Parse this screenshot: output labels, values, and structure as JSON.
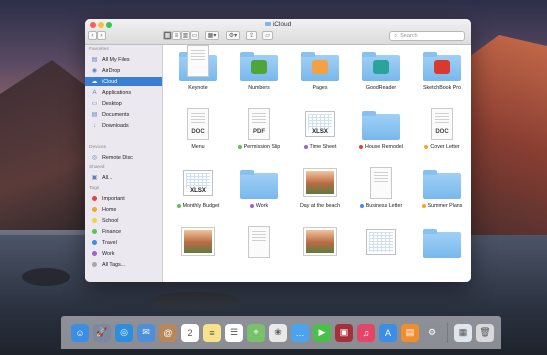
{
  "window": {
    "title": "iCloud"
  },
  "toolbar": {
    "search_placeholder": "Search"
  },
  "sidebar": {
    "favorites_label": "Favorites",
    "favorites": [
      {
        "label": "All My Files",
        "icon": "all-files-icon"
      },
      {
        "label": "AirDrop",
        "icon": "airdrop-icon"
      },
      {
        "label": "iCloud",
        "icon": "icloud-icon",
        "selected": true
      },
      {
        "label": "Applications",
        "icon": "applications-icon"
      },
      {
        "label": "Desktop",
        "icon": "desktop-icon"
      },
      {
        "label": "Documents",
        "icon": "documents-icon"
      },
      {
        "label": "Downloads",
        "icon": "downloads-icon"
      }
    ],
    "devices_label": "Devices",
    "devices": [
      {
        "label": "Remote Disc",
        "icon": "disc-icon"
      }
    ],
    "shared_label": "Shared",
    "shared": [
      {
        "label": "All...",
        "icon": "network-icon"
      }
    ],
    "tags_label": "Tags",
    "tags": [
      {
        "label": "Important",
        "color": "#e0443e"
      },
      {
        "label": "Home",
        "color": "#f5a623"
      },
      {
        "label": "School",
        "color": "#f0d53a"
      },
      {
        "label": "Finance",
        "color": "#5cc351"
      },
      {
        "label": "Travel",
        "color": "#3d8ee0"
      },
      {
        "label": "Work",
        "color": "#a35ed0"
      },
      {
        "label": "All Tags...",
        "color": "#a7a7a7"
      }
    ]
  },
  "files": [
    {
      "name": "Keynote",
      "kind": "app-folder",
      "badge": "#2f7fe0"
    },
    {
      "name": "Numbers",
      "kind": "app-folder",
      "badge": "#4fa43a"
    },
    {
      "name": "Pages",
      "kind": "app-folder",
      "badge": "#f4a142"
    },
    {
      "name": "GoodReader",
      "kind": "app-folder",
      "badge": "#2aa39a"
    },
    {
      "name": "SketchBook Pro",
      "kind": "app-folder",
      "badge": "#d93a2f"
    },
    {
      "name": "Menu",
      "kind": "doc",
      "label": "DOC"
    },
    {
      "name": "Permission Slip",
      "kind": "doc",
      "label": "PDF",
      "tag": "#5cc351"
    },
    {
      "name": "Time Sheet",
      "kind": "sheet",
      "label": "XLSX",
      "tag": "#a35ed0"
    },
    {
      "name": "House Remodel",
      "kind": "folder",
      "tag": "#e0443e"
    },
    {
      "name": "Cover Letter",
      "kind": "doc",
      "label": "DOC",
      "tag": "#f5a623"
    },
    {
      "name": "Monthly Budget",
      "kind": "sheet",
      "label": "XLSX",
      "tag": "#5cc351"
    },
    {
      "name": "Work",
      "kind": "folder",
      "tag": "#a35ed0"
    },
    {
      "name": "Day at the beach",
      "kind": "photo"
    },
    {
      "name": "Business Letter",
      "kind": "doc",
      "label": "",
      "tag": "#3d8ee0"
    },
    {
      "name": "Summer Plans",
      "kind": "folder",
      "tag": "#f5a623"
    },
    {
      "name": "",
      "kind": "photo"
    },
    {
      "name": "",
      "kind": "doc",
      "label": ""
    },
    {
      "name": "",
      "kind": "photo"
    },
    {
      "name": "",
      "kind": "sheet",
      "label": ""
    },
    {
      "name": "",
      "kind": "folder"
    },
    {
      "name": "",
      "kind": "doc",
      "label": ""
    }
  ],
  "dock": {
    "apps": [
      {
        "name": "finder-icon",
        "color": "#3b8ee4",
        "glyph": "☺"
      },
      {
        "name": "launchpad-icon",
        "color": "#7a8aa0",
        "glyph": "🚀"
      },
      {
        "name": "safari-icon",
        "color": "#2f8de0",
        "glyph": "◎"
      },
      {
        "name": "mail-icon",
        "color": "#4f8ed8",
        "glyph": "✉"
      },
      {
        "name": "contacts-icon",
        "color": "#b8875b",
        "glyph": "@"
      },
      {
        "name": "calendar-icon",
        "color": "#ffffff",
        "glyph": "2"
      },
      {
        "name": "notes-icon",
        "color": "#f7e18a",
        "glyph": "≡"
      },
      {
        "name": "reminders-icon",
        "color": "#ffffff",
        "glyph": "☰"
      },
      {
        "name": "maps-icon",
        "color": "#79c16b",
        "glyph": "⌖"
      },
      {
        "name": "photos-icon",
        "color": "#e9e9e9",
        "glyph": "❀"
      },
      {
        "name": "messages-icon",
        "color": "#4aa3ec",
        "glyph": "…"
      },
      {
        "name": "facetime-icon",
        "color": "#4cbf4a",
        "glyph": "▶"
      },
      {
        "name": "photobooth-icon",
        "color": "#a5303a",
        "glyph": "▣"
      },
      {
        "name": "itunes-icon",
        "color": "#e4466a",
        "glyph": "♫"
      },
      {
        "name": "appstore-icon",
        "color": "#3a8ee6",
        "glyph": "A"
      },
      {
        "name": "ibooks-icon",
        "color": "#f08d2c",
        "glyph": "▤"
      },
      {
        "name": "system-preferences-icon",
        "color": "#8a8f96",
        "glyph": "⚙"
      }
    ],
    "extras": [
      {
        "name": "documents-stack-icon",
        "color": "#dfe6ee",
        "glyph": "▦"
      },
      {
        "name": "trash-icon",
        "color": "#d7d9dc",
        "glyph": "🗑"
      }
    ]
  }
}
